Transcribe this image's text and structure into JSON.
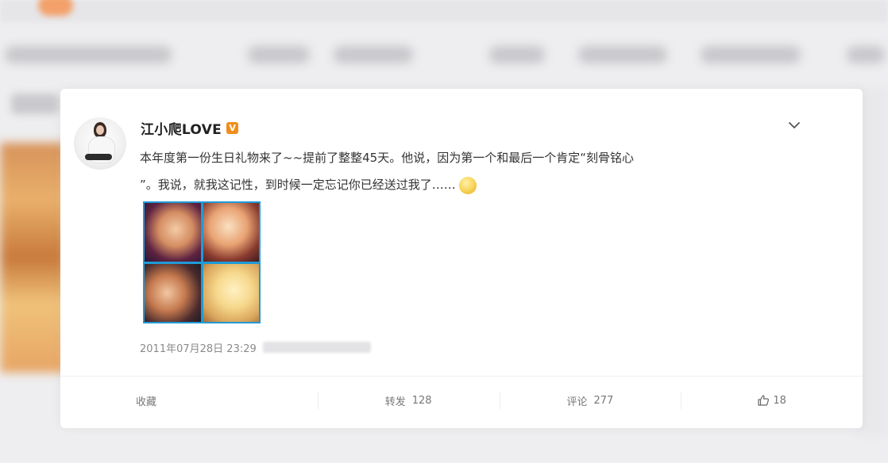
{
  "post": {
    "author": "江小爬LOVE",
    "vip_badge": "V",
    "text_line1": "本年度第一份生日礼物来了~~提前了整整45天。他说，因为第一个和最后一个肯定“刻骨铭心",
    "text_line2": "”。我说，就我这记性，到时候一定忘记你已经送过我了……",
    "timestamp": "2011年07月28日 23:29"
  },
  "actions": {
    "favorite_label": "收藏",
    "repost_label": "转发",
    "repost_count": "128",
    "comment_label": "评论",
    "comment_count": "277",
    "like_count": "18"
  },
  "colors": {
    "accent_vip": "#f08d1a",
    "photo_border": "#1f9bd6"
  },
  "icons": [
    "chevron-down-icon",
    "thumbs-up-icon",
    "vip-badge-icon",
    "emoji-icon"
  ]
}
